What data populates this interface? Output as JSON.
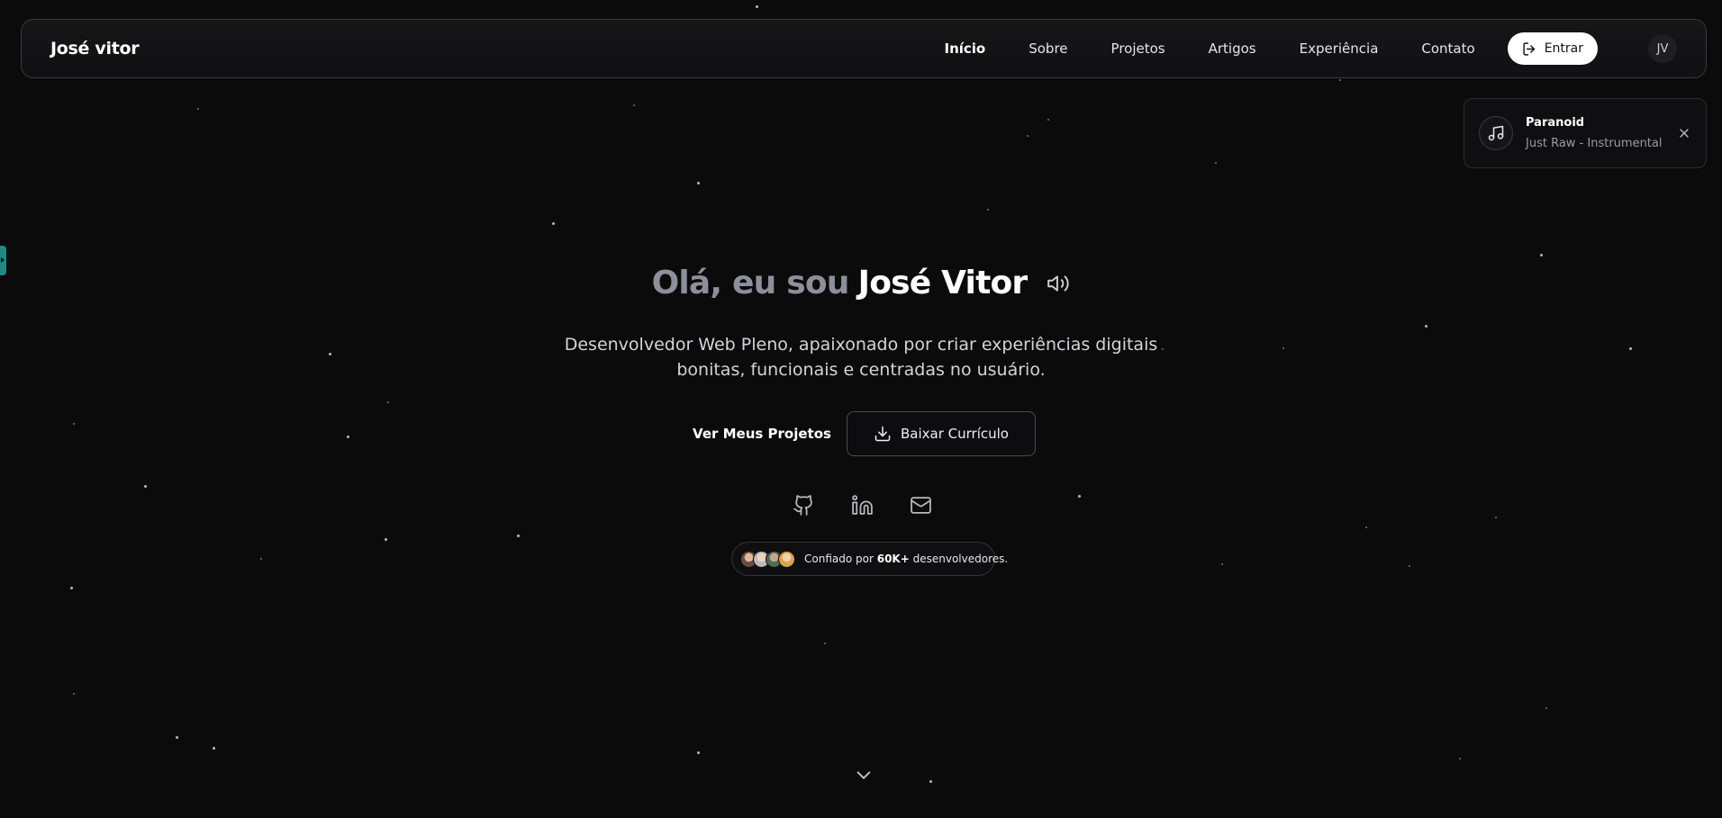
{
  "nav": {
    "brand": "José vitor",
    "links": [
      {
        "label": "Início",
        "active": true
      },
      {
        "label": "Sobre",
        "active": false
      },
      {
        "label": "Projetos",
        "active": false
      },
      {
        "label": "Artigos",
        "active": false
      },
      {
        "label": "Experiência",
        "active": false
      },
      {
        "label": "Contato",
        "active": false
      }
    ],
    "login_label": "Entrar",
    "avatar_initials": "JV",
    "login_icon": "log-in-icon"
  },
  "music": {
    "title": "Paranoid",
    "artist": "Just Raw - Instrumental",
    "icon": "music-note-icon",
    "close_icon": "close-icon"
  },
  "hero": {
    "greeting": "Olá, eu sou",
    "name": "José Vitor",
    "sound_icon": "volume-icon",
    "subtitle_line1": "Desenvolvedor Web Pleno, apaixonado por criar experiências digitais",
    "subtitle_line2": "bonitas, funcionais e centradas no usuário.",
    "primary_cta": "Ver Meus Projetos",
    "secondary_cta": "Baixar Currículo",
    "secondary_cta_icon": "download-icon"
  },
  "social": [
    {
      "name": "github",
      "icon": "github-icon"
    },
    {
      "name": "linkedin",
      "icon": "linkedin-icon"
    },
    {
      "name": "email",
      "icon": "mail-icon"
    }
  ],
  "trust": {
    "prefix": "Confiado por",
    "count": "60K+",
    "suffix": "desenvolvedores."
  },
  "scroll_icon": "chevron-down-icon",
  "colors": {
    "background": "#0b0b0c",
    "accent_tab": "#1e8c82",
    "greeting_gray": "#8d8f9a"
  }
}
